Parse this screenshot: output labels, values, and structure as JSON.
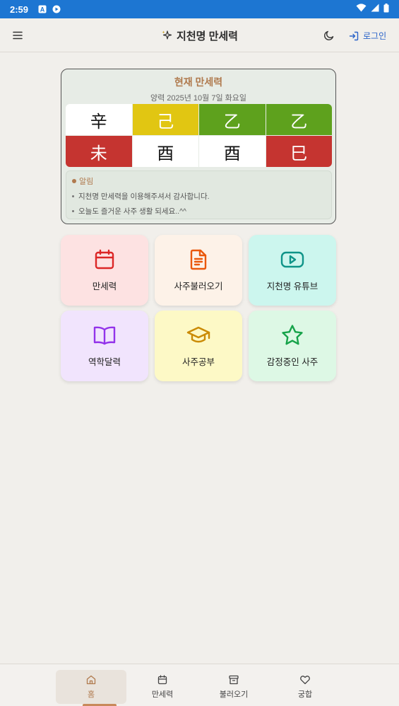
{
  "status_bar": {
    "time": "2:59"
  },
  "app_bar": {
    "title": "지천명 만세력",
    "login_label": "로그인"
  },
  "calendar": {
    "title": "현재 만세력",
    "date": "양력 2025년 10월 7일 화요일",
    "heavenly_stems": [
      {
        "char": "辛",
        "color": "#ffffff"
      },
      {
        "char": "己",
        "color": "#e1c612"
      },
      {
        "char": "乙",
        "color": "#5ea11d"
      },
      {
        "char": "乙",
        "color": "#5ea11d"
      }
    ],
    "earthly_branches": [
      {
        "char": "未",
        "color": "#c53430"
      },
      {
        "char": "酉",
        "color": "#ffffff"
      },
      {
        "char": "酉",
        "color": "#ffffff"
      },
      {
        "char": "巳",
        "color": "#c53430"
      }
    ],
    "notice": {
      "title": "알림",
      "items": [
        "지천명 만세력을 이용해주셔서 감사합니다.",
        "오늘도 즐거운 사주 생활 되세요..^^"
      ]
    }
  },
  "tiles": [
    {
      "label": "만세력",
      "icon": "calendar-icon",
      "bg": "#fde2e2",
      "icon_color": "#dc2626"
    },
    {
      "label": "사주불러오기",
      "icon": "document-icon",
      "bg": "#fdf2e8",
      "icon_color": "#ea580c"
    },
    {
      "label": "지천명 유튜브",
      "icon": "youtube-icon",
      "bg": "#ccf6ee",
      "icon_color": "#0f9488"
    },
    {
      "label": "역학달력",
      "icon": "book-icon",
      "bg": "#f1e4fd",
      "icon_color": "#9333ea"
    },
    {
      "label": "사주공부",
      "icon": "graduation-cap-icon",
      "bg": "#fdf9c6",
      "icon_color": "#ca8a04"
    },
    {
      "label": "감정중인 사주",
      "icon": "star-icon",
      "bg": "#ddf8e5",
      "icon_color": "#16a34a"
    }
  ],
  "bottom_nav": [
    {
      "label": "홈",
      "icon": "home-icon",
      "active": true
    },
    {
      "label": "만세력",
      "icon": "calendar-icon",
      "active": false
    },
    {
      "label": "불러오기",
      "icon": "archive-icon",
      "active": false
    },
    {
      "label": "궁합",
      "icon": "heart-icon",
      "active": false
    }
  ],
  "colors": {
    "accent": "#b07a4e",
    "status_bar": "#1d76d2",
    "link": "#2a63c9"
  }
}
